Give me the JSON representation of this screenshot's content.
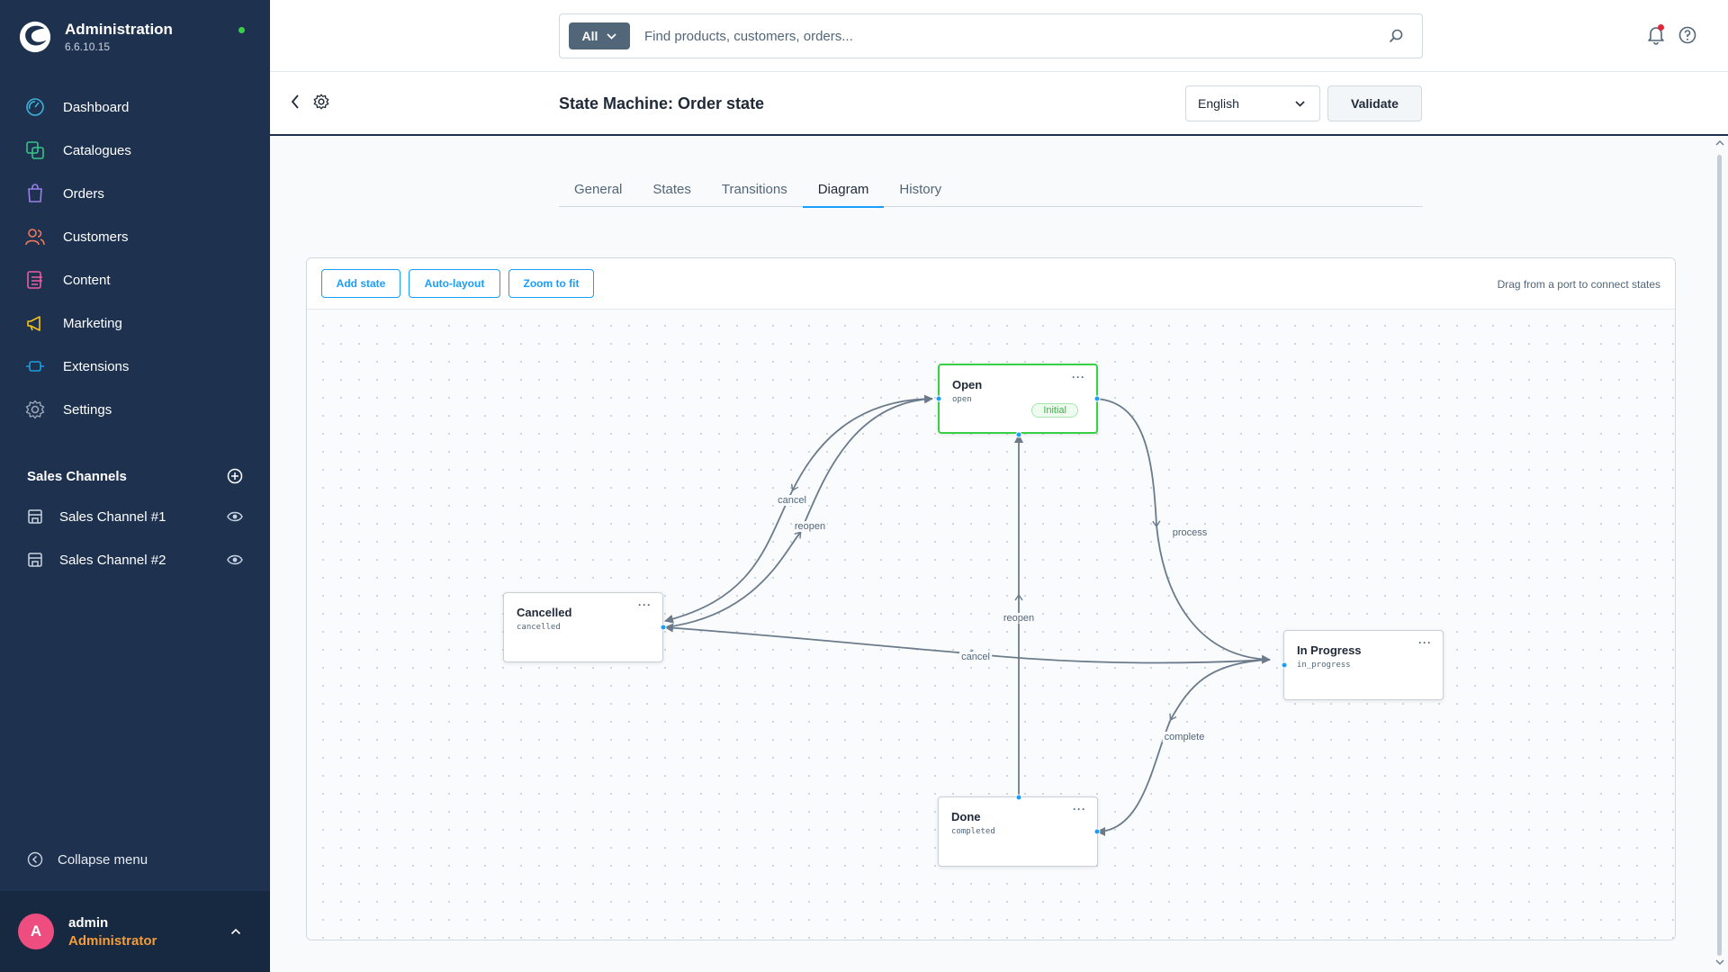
{
  "app": {
    "title": "Administration",
    "version": "6.6.10.15"
  },
  "sidebar": {
    "nav": [
      {
        "label": "Dashboard",
        "icon": "dashboard-icon"
      },
      {
        "label": "Catalogues",
        "icon": "catalogue-icon"
      },
      {
        "label": "Orders",
        "icon": "orders-icon"
      },
      {
        "label": "Customers",
        "icon": "customers-icon"
      },
      {
        "label": "Content",
        "icon": "content-icon"
      },
      {
        "label": "Marketing",
        "icon": "marketing-icon"
      },
      {
        "label": "Extensions",
        "icon": "extensions-icon"
      },
      {
        "label": "Settings",
        "icon": "settings-icon"
      }
    ],
    "sales_channels": {
      "title": "Sales Channels",
      "items": [
        {
          "label": "Sales Channel #1"
        },
        {
          "label": "Sales Channel #2"
        }
      ]
    },
    "collapse_label": "Collapse menu",
    "user": {
      "initial": "A",
      "name": "admin",
      "role": "Administrator"
    }
  },
  "search": {
    "type_label": "All",
    "placeholder": "Find products, customers, orders..."
  },
  "page": {
    "title": "State Machine: Order state",
    "language": "English",
    "validate_label": "Validate"
  },
  "tabs": [
    {
      "label": "General",
      "active": false
    },
    {
      "label": "States",
      "active": false
    },
    {
      "label": "Transitions",
      "active": false
    },
    {
      "label": "Diagram",
      "active": true
    },
    {
      "label": "History",
      "active": false
    }
  ],
  "toolbar": {
    "add_state": "Add state",
    "auto_layout": "Auto-layout",
    "zoom_to_fit": "Zoom to fit",
    "hint": "Drag from a port to connect states"
  },
  "states": [
    {
      "id": "open",
      "name": "Open",
      "technical_name": "open",
      "initial": true,
      "badge": "Initial"
    },
    {
      "id": "cancelled",
      "name": "Cancelled",
      "technical_name": "cancelled",
      "initial": false
    },
    {
      "id": "in_progress",
      "name": "In Progress",
      "technical_name": "in_progress",
      "initial": false
    },
    {
      "id": "done",
      "name": "Done",
      "technical_name": "completed",
      "initial": false
    }
  ],
  "transitions": [
    {
      "label": "cancel",
      "from": "open",
      "to": "cancelled"
    },
    {
      "label": "reopen",
      "from": "cancelled",
      "to": "open"
    },
    {
      "label": "process",
      "from": "open",
      "to": "in_progress"
    },
    {
      "label": "reopen",
      "from": "done",
      "to": "open"
    },
    {
      "label": "cancel",
      "from": "in_progress",
      "to": "cancelled"
    },
    {
      "label": "complete",
      "from": "in_progress",
      "to": "done"
    }
  ],
  "node_menu_label": "···",
  "colors": {
    "sidebar": "#1e3250",
    "accent": "#189eff",
    "initial_border": "#37d046",
    "edge": "#6b7b8c"
  }
}
